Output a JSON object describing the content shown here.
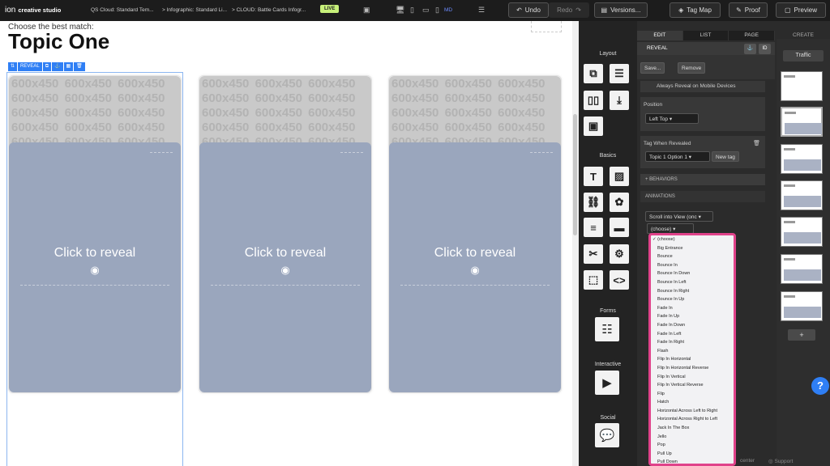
{
  "app": {
    "logo": "ion",
    "name": "creative studio"
  },
  "breadcrumbs": [
    "QS Cloud: Standard Tem...",
    "> Infographic: Standard Li...",
    "> CLOUD: Battle Cards Infogr..."
  ],
  "status_badge": "LIVE",
  "device_label": "MD",
  "toolbar": {
    "undo": "Undo",
    "redo": "Redo",
    "versions": "Versions...",
    "tag_map": "Tag Map",
    "proof": "Proof",
    "preview": "Preview"
  },
  "page": {
    "subtitle": "Choose the best match:",
    "title": "Topic One"
  },
  "element_toolbar": {
    "reveal": "REVEAL"
  },
  "cards": [
    {
      "placeholder": "600x450 600x450 600x450 600x450 600x450 600x450 600x450 600x450 600x450 600x450 600x450 600x450 600x450 600x450 600x450",
      "cta": "Click to reveal"
    },
    {
      "placeholder": "600x450 600x450 600x450 600x450 600x450 600x450 600x450 600x450 600x450 600x450 600x450 600x450 600x450 600x450 600x450",
      "cta": "Click to reveal"
    },
    {
      "placeholder": "600x450 600x450 600x450 600x450 600x450 600x450 600x450 600x450 600x450 600x450 600x450 600x450 600x450 600x450 600x450",
      "cta": "Click to reveal"
    }
  ],
  "panel": {
    "sections": {
      "layout": "Layout",
      "basics": "Basics",
      "forms": "Forms",
      "interactive": "Interactive",
      "social": "Social"
    },
    "tabs": [
      "EDIT",
      "LIST",
      "PAGE"
    ],
    "create": "CREATE",
    "settings_header": "REVEAL",
    "id_button": "ID",
    "save": "Save...",
    "remove": "Remove",
    "always_reveal": "Always Reveal on Mobile Devices",
    "position_label": "Position",
    "position_value": "Left Top",
    "tag_label": "Tag When Revealed",
    "tag_value": "Topic 1 Option 1",
    "new_tag": "New tag",
    "behaviors": "+ BEHAVIORS",
    "animations": "ANIMATIONS",
    "scroll_select": "Scroll into View (onc",
    "choose_select": "(choose)",
    "traffic": "Traffic"
  },
  "animation_options": [
    "✓ (choose)",
    "Big Entrance",
    "Bounce",
    "Bounce In",
    "Bounce In Down",
    "Bounce In Left",
    "Bounce In Right",
    "Bounce In Up",
    "Fade In",
    "Fade In Up",
    "Fade In Down",
    "Fade In Left",
    "Fade In Right",
    "Flash",
    "Flip In Horizontal",
    "Flip In Horizontal Reverse",
    "Flip In Vertical",
    "Flip In Vertical Reverse",
    "Flip",
    "Hatch",
    "Horizontal Across Left to Right",
    "Horizontal Across Right to Left",
    "Jack In The Box",
    "Jello",
    "Pop",
    "Pull Up",
    "Pull Down"
  ],
  "footer": {
    "center": "center",
    "support": "Support"
  }
}
